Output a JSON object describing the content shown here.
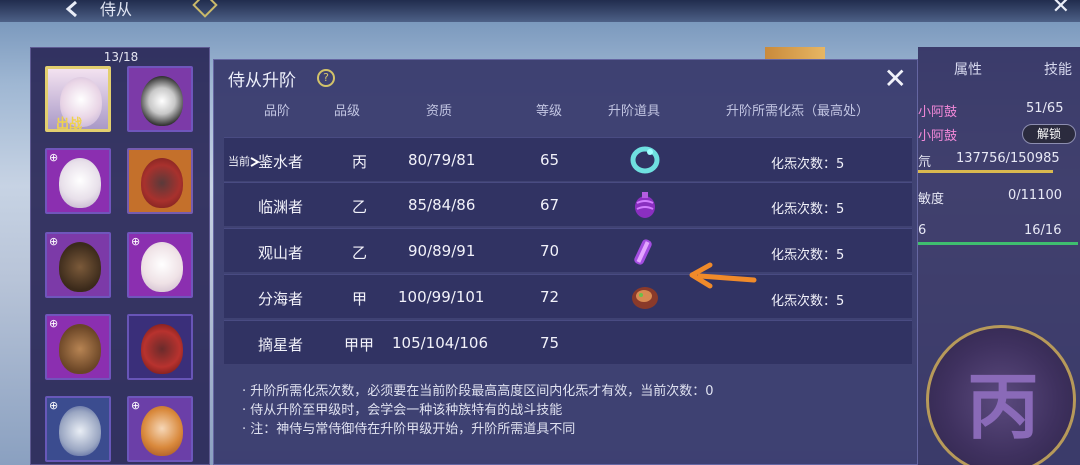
{
  "topbar": {
    "title": "侍从"
  },
  "roster": {
    "count": "13/18",
    "selected_tag": "出战"
  },
  "modal": {
    "title": "侍从升阶",
    "help_glyph": "?",
    "headers": [
      "品阶",
      "品级",
      "资质",
      "等级",
      "升阶道具",
      "升阶所需化炁（最高处）"
    ],
    "current_marker": "当前",
    "rows": [
      {
        "rank": "鉴水者",
        "grade": "丙",
        "aptitude": "80/79/81",
        "level": "65",
        "effect": "化炁次数：5",
        "item": "ring-item-icon",
        "current": true
      },
      {
        "rank": "临渊者",
        "grade": "乙",
        "aptitude": "85/84/86",
        "level": "67",
        "effect": "化炁次数：5",
        "item": "purple-bell-item-icon"
      },
      {
        "rank": "观山者",
        "grade": "乙",
        "aptitude": "90/89/91",
        "level": "70",
        "effect": "化炁次数：5",
        "item": "scroll-item-icon"
      },
      {
        "rank": "分海者",
        "grade": "甲",
        "aptitude": "100/99/101",
        "level": "72",
        "effect": "化炁次数：5",
        "item": "meat-item-icon"
      },
      {
        "rank": "摘星者",
        "grade": "甲甲",
        "aptitude": "105/104/106",
        "level": "75",
        "effect": ""
      }
    ],
    "notes": [
      "· 升阶所需化炁次数，必须要在当前阶段最高高度区间内化炁才有效，当前次数：0",
      "· 侍从升阶至甲级时，会学会一种该种族特有的战斗技能",
      "· 注：神侍与常侍御侍在升阶甲级开始，升阶所需道具不同"
    ]
  },
  "right_panel": {
    "tabs": [
      "属性",
      "技能"
    ],
    "name": "小阿鼓",
    "level_value": "51/65",
    "name2": "小阿鼓",
    "unlock_label": "解锁",
    "stat1_label": "氘",
    "stat1_value": "137756/150985",
    "stat2_label": "敏度",
    "stat2_value": "0/11100",
    "stat3_label": "6",
    "stat3_value": "16/16",
    "seal_glyph": "丙"
  },
  "colors": {
    "accent_gold": "#e3cf6f",
    "arrow": "#f08a2a",
    "pink": "#f088d8"
  }
}
